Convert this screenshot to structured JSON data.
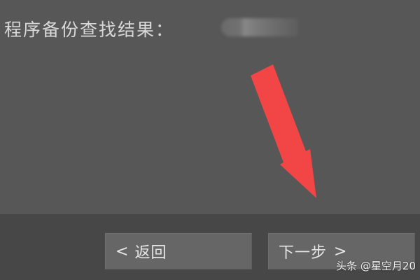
{
  "content": {
    "result_label": "程序备份查找结果："
  },
  "buttons": {
    "back": {
      "glyph": "<",
      "label": "返回"
    },
    "next": {
      "label": "下一步",
      "glyph": ">"
    }
  },
  "watermark": "头条 @星空月20",
  "colors": {
    "background": "#575757",
    "footer": "#474747",
    "button": "#666666",
    "annotation_arrow": "#f24646"
  },
  "icons": {
    "annotation": "red-arrow-icon"
  }
}
